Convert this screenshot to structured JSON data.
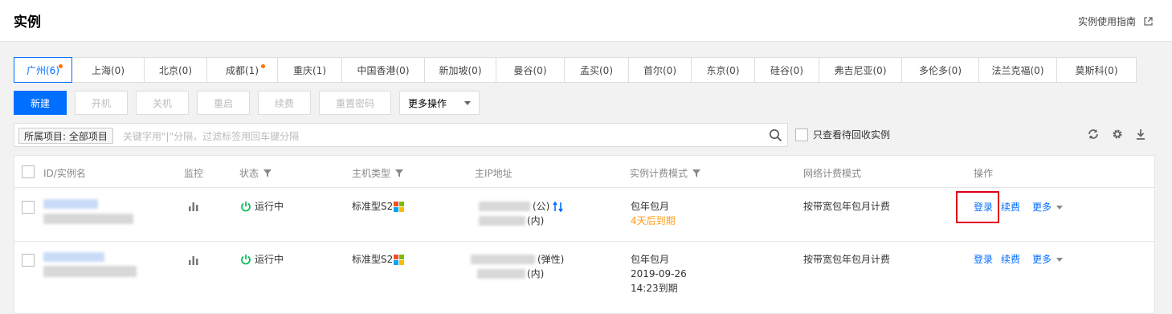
{
  "header": {
    "title": "实例",
    "guide_link": "实例使用指南"
  },
  "regions": [
    {
      "label": "广州(6)",
      "active": true,
      "dot": true
    },
    {
      "label": "上海(0)"
    },
    {
      "label": "北京(0)"
    },
    {
      "label": "成都(1)",
      "dot": true
    },
    {
      "label": "重庆(1)"
    },
    {
      "label": "中国香港(0)"
    },
    {
      "label": "新加坡(0)"
    },
    {
      "label": "曼谷(0)"
    },
    {
      "label": "孟买(0)"
    },
    {
      "label": "首尔(0)"
    },
    {
      "label": "东京(0)"
    },
    {
      "label": "硅谷(0)"
    },
    {
      "label": "弗吉尼亚(0)"
    },
    {
      "label": "多伦多(0)"
    },
    {
      "label": "法兰克福(0)"
    },
    {
      "label": "莫斯科(0)"
    }
  ],
  "toolbar": {
    "new_label": "新建",
    "start_label": "开机",
    "shutdown_label": "关机",
    "restart_label": "重启",
    "renew_label": "续费",
    "reset_password_label": "重置密码",
    "more_ops_label": "更多操作"
  },
  "search": {
    "project_tag": "所属项目: 全部项目",
    "placeholder": "关键字用\"|\"分隔，过滤标签用回车键分隔"
  },
  "recycle_checkbox_label": "只查看待回收实例",
  "table": {
    "headers": {
      "id_name": "ID/实例名",
      "monitor": "监控",
      "status": "状态",
      "host_type": "主机类型",
      "ip": "主IP地址",
      "billing": "实例计费模式",
      "net_billing": "网络计费模式",
      "ops": "操作"
    },
    "rows": [
      {
        "status": "运行中",
        "host_type": "标准型S2",
        "ip_public_suffix": "(公)",
        "ip_private_suffix": "(内)",
        "billing": "包年包月",
        "billing_note": "4天后到期",
        "net_billing": "按带宽包年包月计费",
        "login": "登录",
        "renew": "续费",
        "more": "更多"
      },
      {
        "status": "运行中",
        "host_type": "标准型S2",
        "ip_public_suffix": "(弹性)",
        "ip_private_suffix": "(内)",
        "billing": "包年包月",
        "billing_date": "2019-09-26",
        "billing_expire": "14:23到期",
        "net_billing": "按带宽包年包月计费",
        "login": "登录",
        "renew": "续费",
        "more": "更多"
      }
    ]
  },
  "colors": {
    "primary": "#006eff",
    "warning": "#ff9c19",
    "running": "#0abf5b",
    "highlight_box": "#e0001a"
  },
  "icons": [
    "external-link-icon",
    "search-icon",
    "refresh-icon",
    "gear-icon",
    "download-icon",
    "bar-chart-icon",
    "power-icon",
    "windows-icon",
    "swap-ip-icon"
  ]
}
